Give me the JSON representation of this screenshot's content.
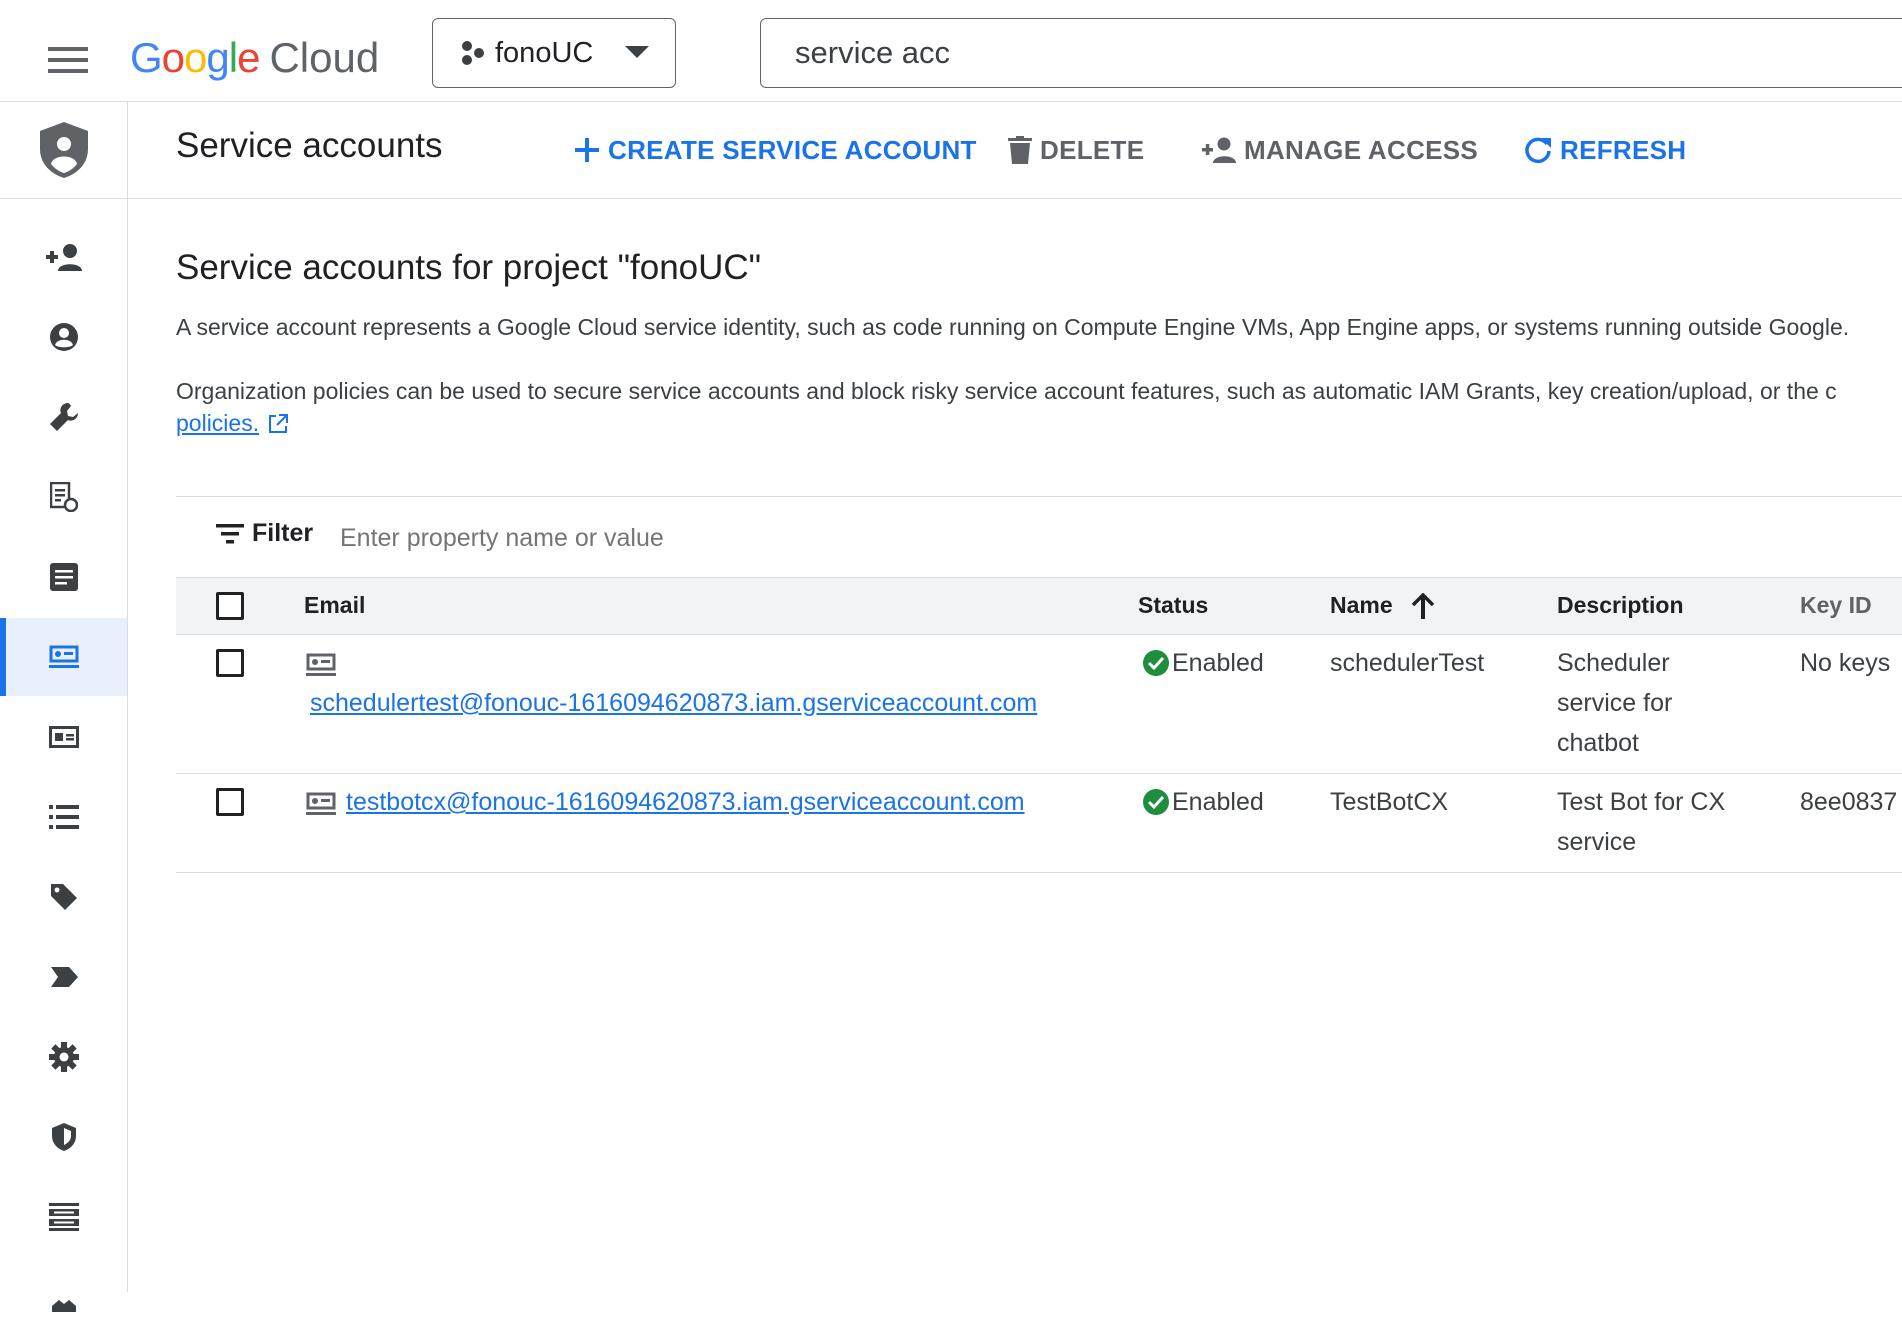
{
  "topbar": {
    "logo_word": "Google",
    "logo_product": "Cloud",
    "project_name": "fonoUC",
    "search_value": "service acc"
  },
  "header": {
    "page_title": "Service accounts",
    "actions": {
      "create": "CREATE SERVICE ACCOUNT",
      "delete": "DELETE",
      "manage": "MANAGE ACCESS",
      "refresh": "REFRESH"
    }
  },
  "main": {
    "section_title": "Service accounts for project \"fonoUC\"",
    "description_1": "A service account represents a Google Cloud service identity, such as code running on Compute Engine VMs, App Engine apps, or systems running outside Google.",
    "description_2": "Organization policies can be used to secure service accounts and block risky service account features, such as automatic IAM Grants, key creation/upload, or the c",
    "policies_link": "policies.",
    "filter_label": "Filter",
    "filter_placeholder": "Enter property name or value"
  },
  "table": {
    "columns": {
      "email": "Email",
      "status": "Status",
      "name": "Name",
      "description": "Description",
      "key_id": "Key ID"
    },
    "rows": [
      {
        "email": "schedulertest@fonouc-1616094620873.iam.gserviceaccount.com",
        "status": "Enabled",
        "name": "schedulerTest",
        "description_lines": [
          "Scheduler",
          "service for",
          "chatbot"
        ],
        "key_id": "No keys"
      },
      {
        "email": "testbotcx@fonouc-1616094620873.iam.gserviceaccount.com",
        "status": "Enabled",
        "name": "TestBotCX",
        "description_lines": [
          "Test Bot for CX",
          "service"
        ],
        "key_id": "8ee0837"
      }
    ]
  },
  "colors": {
    "accent": "#1a73e8",
    "status_green": "#1e8e3e",
    "text": "#202124",
    "muted": "#5f6368"
  }
}
